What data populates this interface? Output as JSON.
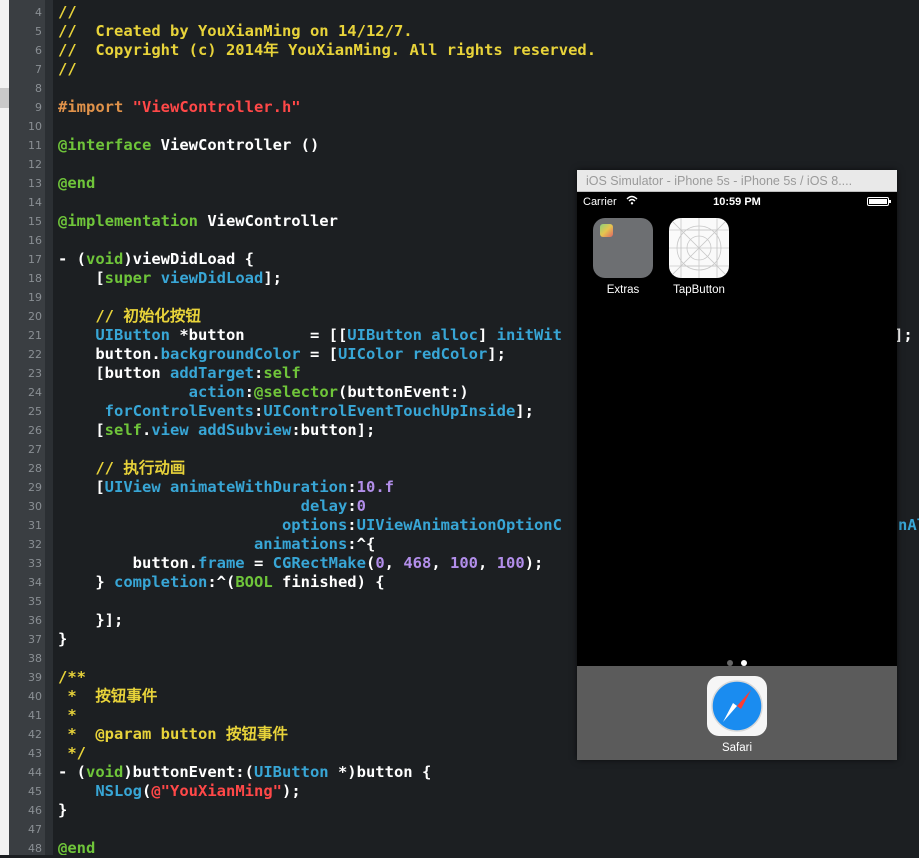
{
  "editor": {
    "line_numbers": [
      "4",
      "5",
      "6",
      "7",
      "8",
      "9",
      "10",
      "11",
      "12",
      "13",
      "14",
      "15",
      "16",
      "17",
      "18",
      "19",
      "20",
      "21",
      "22",
      "23",
      "24",
      "25",
      "26",
      "27",
      "28",
      "29",
      "30",
      "31",
      "32",
      "33",
      "34",
      "35",
      "36",
      "37",
      "38",
      "39",
      "40",
      "41",
      "42",
      "43",
      "44",
      "45",
      "46",
      "47",
      "48"
    ],
    "lines": [
      [
        {
          "t": "//",
          "c": "cm"
        }
      ],
      [
        {
          "t": "//  Created by YouXianMing on 14/12/7.",
          "c": "cm"
        }
      ],
      [
        {
          "t": "//  Copyright (c) 2014年 YouXianMing. All rights reserved.",
          "c": "cm"
        }
      ],
      [
        {
          "t": "//",
          "c": "cm"
        }
      ],
      [],
      [
        {
          "t": "#import ",
          "c": "pp"
        },
        {
          "t": "\"ViewController.h\"",
          "c": "st"
        }
      ],
      [],
      [
        {
          "t": "@interface ",
          "c": "kw"
        },
        {
          "t": "ViewController ()",
          "c": "pl"
        }
      ],
      [],
      [
        {
          "t": "@end",
          "c": "kw"
        }
      ],
      [],
      [
        {
          "t": "@implementation ",
          "c": "kw"
        },
        {
          "t": "ViewController",
          "c": "pl"
        }
      ],
      [],
      [
        {
          "t": "- (",
          "c": "pl"
        },
        {
          "t": "void",
          "c": "kw"
        },
        {
          "t": ")viewDidLoad {",
          "c": "pl"
        }
      ],
      [
        {
          "t": "    [",
          "c": "pl"
        },
        {
          "t": "super",
          "c": "kw"
        },
        {
          "t": " ",
          "c": "pl"
        },
        {
          "t": "viewDidLoad",
          "c": "cl"
        },
        {
          "t": "];",
          "c": "pl"
        }
      ],
      [],
      [
        {
          "t": "    // 初始化按钮",
          "c": "cm"
        }
      ],
      [
        {
          "t": "    ",
          "c": "pl"
        },
        {
          "t": "UIButton",
          "c": "cl"
        },
        {
          "t": " *button       = [[",
          "c": "pl"
        },
        {
          "t": "UIButton",
          "c": "cl"
        },
        {
          "t": " ",
          "c": "pl"
        },
        {
          "t": "alloc",
          "c": "cl"
        },
        {
          "t": "] ",
          "c": "pl"
        },
        {
          "t": "initWit",
          "c": "cl"
        }
      ],
      [
        {
          "t": "    button.",
          "c": "pl"
        },
        {
          "t": "backgroundColor",
          "c": "cl"
        },
        {
          "t": " = [",
          "c": "pl"
        },
        {
          "t": "UIColor",
          "c": "cl"
        },
        {
          "t": " ",
          "c": "pl"
        },
        {
          "t": "redColor",
          "c": "cl"
        },
        {
          "t": "];",
          "c": "pl"
        }
      ],
      [
        {
          "t": "    [button ",
          "c": "pl"
        },
        {
          "t": "addTarget",
          "c": "cl"
        },
        {
          "t": ":",
          "c": "pl"
        },
        {
          "t": "self",
          "c": "kw"
        }
      ],
      [
        {
          "t": "              ",
          "c": "pl"
        },
        {
          "t": "action",
          "c": "cl"
        },
        {
          "t": ":",
          "c": "pl"
        },
        {
          "t": "@selector",
          "c": "kw"
        },
        {
          "t": "(buttonEvent:)",
          "c": "pl"
        }
      ],
      [
        {
          "t": "     ",
          "c": "pl"
        },
        {
          "t": "forControlEvents",
          "c": "cl"
        },
        {
          "t": ":",
          "c": "pl"
        },
        {
          "t": "UIControlEventTouchUpInside",
          "c": "cl"
        },
        {
          "t": "];",
          "c": "pl"
        }
      ],
      [
        {
          "t": "    [",
          "c": "pl"
        },
        {
          "t": "self",
          "c": "kw"
        },
        {
          "t": ".",
          "c": "pl"
        },
        {
          "t": "view",
          "c": "cl"
        },
        {
          "t": " ",
          "c": "pl"
        },
        {
          "t": "addSubview",
          "c": "cl"
        },
        {
          "t": ":button];",
          "c": "pl"
        }
      ],
      [],
      [
        {
          "t": "    // 执行动画",
          "c": "cm"
        }
      ],
      [
        {
          "t": "    [",
          "c": "pl"
        },
        {
          "t": "UIView",
          "c": "cl"
        },
        {
          "t": " ",
          "c": "pl"
        },
        {
          "t": "animateWithDuration",
          "c": "cl"
        },
        {
          "t": ":",
          "c": "pl"
        },
        {
          "t": "10.f",
          "c": "nm"
        }
      ],
      [
        {
          "t": "                          ",
          "c": "pl"
        },
        {
          "t": "delay",
          "c": "cl"
        },
        {
          "t": ":",
          "c": "pl"
        },
        {
          "t": "0",
          "c": "nm"
        }
      ],
      [
        {
          "t": "                        ",
          "c": "pl"
        },
        {
          "t": "options",
          "c": "cl"
        },
        {
          "t": ":",
          "c": "pl"
        },
        {
          "t": "UIViewAnimationOptionC",
          "c": "cl"
        }
      ],
      [
        {
          "t": "                     ",
          "c": "pl"
        },
        {
          "t": "animations",
          "c": "cl"
        },
        {
          "t": ":^{",
          "c": "pl"
        }
      ],
      [
        {
          "t": "        button.",
          "c": "pl"
        },
        {
          "t": "frame",
          "c": "cl"
        },
        {
          "t": " = ",
          "c": "pl"
        },
        {
          "t": "CGRectMake",
          "c": "cl"
        },
        {
          "t": "(",
          "c": "pl"
        },
        {
          "t": "0",
          "c": "nm"
        },
        {
          "t": ", ",
          "c": "pl"
        },
        {
          "t": "468",
          "c": "nm"
        },
        {
          "t": ", ",
          "c": "pl"
        },
        {
          "t": "100",
          "c": "nm"
        },
        {
          "t": ", ",
          "c": "pl"
        },
        {
          "t": "100",
          "c": "nm"
        },
        {
          "t": ");",
          "c": "pl"
        }
      ],
      [
        {
          "t": "    } ",
          "c": "pl"
        },
        {
          "t": "completion",
          "c": "cl"
        },
        {
          "t": ":^(",
          "c": "pl"
        },
        {
          "t": "BOOL",
          "c": "kw"
        },
        {
          "t": " finished) {",
          "c": "pl"
        }
      ],
      [],
      [
        {
          "t": "    }];",
          "c": "pl"
        }
      ],
      [
        {
          "t": "}",
          "c": "pl"
        }
      ],
      [],
      [
        {
          "t": "/**",
          "c": "cm"
        }
      ],
      [
        {
          "t": " *  按钮事件",
          "c": "cm"
        }
      ],
      [
        {
          "t": " *",
          "c": "cm"
        }
      ],
      [
        {
          "t": " *  @param button 按钮事件",
          "c": "cm"
        }
      ],
      [
        {
          "t": " */",
          "c": "cm"
        }
      ],
      [
        {
          "t": "- (",
          "c": "pl"
        },
        {
          "t": "void",
          "c": "kw"
        },
        {
          "t": ")buttonEvent:(",
          "c": "pl"
        },
        {
          "t": "UIButton",
          "c": "cl"
        },
        {
          "t": " *)button {",
          "c": "pl"
        }
      ],
      [
        {
          "t": "    ",
          "c": "pl"
        },
        {
          "t": "NSLog",
          "c": "cl"
        },
        {
          "t": "(",
          "c": "pl"
        },
        {
          "t": "@\"YouXianMing\"",
          "c": "st"
        },
        {
          "t": ");",
          "c": "pl"
        }
      ],
      [
        {
          "t": "}",
          "c": "pl"
        }
      ],
      [],
      [
        {
          "t": "@end",
          "c": "kw"
        }
      ]
    ],
    "right_edge": [
      {
        "line": 21,
        "text": "];"
      },
      {
        "line": 31,
        "text": "nAl"
      }
    ]
  },
  "simulator": {
    "title": "iOS Simulator - iPhone 5s - iPhone 5s / iOS 8....",
    "status": {
      "carrier": "Carrier",
      "time": "10:59 PM"
    },
    "apps": [
      {
        "id": "extras",
        "label": "Extras",
        "icon": "folder-icon"
      },
      {
        "id": "tap",
        "label": "TapButton",
        "icon": "app-template-grid-icon"
      }
    ],
    "dock": [
      {
        "id": "safari",
        "label": "Safari",
        "icon": "safari-compass-icon"
      }
    ],
    "page_dots": {
      "count": 2,
      "active": 1
    }
  },
  "colors": {
    "editor_bg": "#1c1f22",
    "comment": "#e8d33a",
    "keyword": "#6fc53a",
    "preprocessor": "#e0924a",
    "string": "#ff4848",
    "class": "#38a6d6",
    "number": "#b28eea",
    "plain": "#ffffff"
  }
}
